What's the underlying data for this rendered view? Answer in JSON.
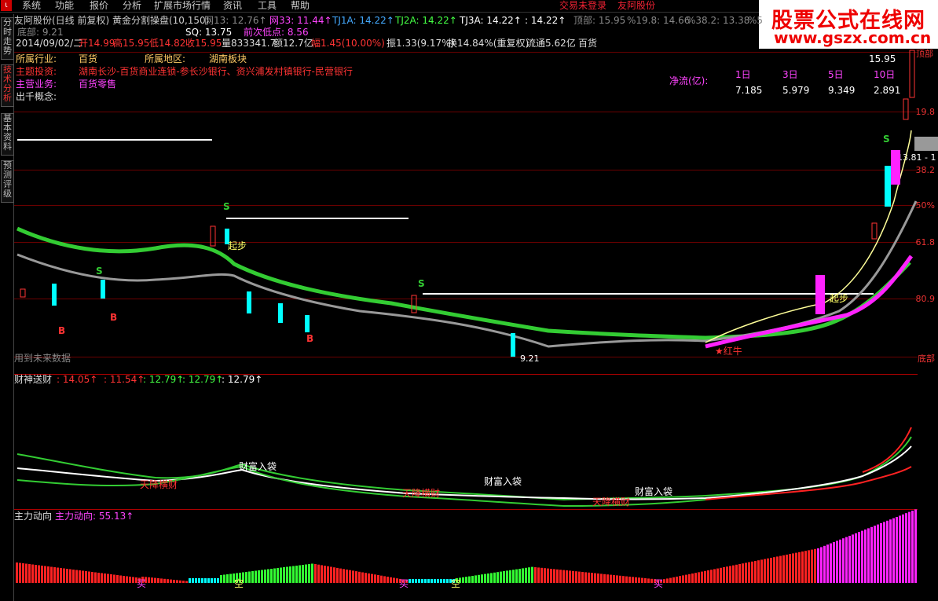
{
  "menu": {
    "items": [
      "系统",
      "功能",
      "报价",
      "分析",
      "扩展市场行情",
      "资讯",
      "工具",
      "帮助"
    ],
    "status": "交易未登录",
    "stock_name": "友阿股份"
  },
  "sidebar": {
    "tabs": [
      "分时走势",
      "技术分析",
      "基本资料",
      "预测评级"
    ]
  },
  "header": {
    "title": "友阿股份(日线 前复权) 黄金分割操盘(10,150)",
    "indicators": [
      {
        "label": "网13: 12.76↑",
        "color": "#888888"
      },
      {
        "label": "网33: 11.44↑",
        "color": "#ff44ff"
      },
      {
        "label": "TJ1A: 14.22↑",
        "color": "#44aaff"
      },
      {
        "label": "TJ2A: 14.22↑",
        "color": "#44ff44"
      },
      {
        "label": "TJ3A: 14.22↑",
        "color": "#ffffff"
      },
      {
        "label": ": 14.22↑",
        "color": "#ffffff"
      },
      {
        "label": "顶部: 15.95",
        "color": "#888888"
      },
      {
        "label": "%19.8: 14.66",
        "color": "#888888"
      },
      {
        "label": "%38.2: 13.38",
        "color": "#888888"
      },
      {
        "label": "%5",
        "color": "#888888"
      }
    ],
    "bottom_label": "底部: 9.21",
    "sq": "SQ: 13.75",
    "prev_low": "前次低点: 8.56"
  },
  "quote_line": {
    "date": "2014/09/02/二",
    "open": "开14.99",
    "high": "高15.95",
    "low": "低14.82",
    "close": "收15.95",
    "volume": "量833341.7",
    "amount": "额12.7亿",
    "change": "幅1.45(10.00%)",
    "amplitude": "振1.33(9.17%)",
    "turnover": "换14.84%(重复权)",
    "float": "流通5.62亿",
    "industry_tag": "百货"
  },
  "info": {
    "industry_label": "所属行业:",
    "industry_value": "百货",
    "region_label": "所属地区:",
    "region_value": "湖南板块",
    "invest_label": "主题投资:",
    "invest_value": "湖南长沙-百货商业连锁-参长沙银行、资兴浦发村镇银行-民营银行",
    "business_label": "主营业务:",
    "business_value": "百货零售",
    "concept_label": "出千概念:"
  },
  "net_flow": {
    "label": "净流(亿):",
    "periods": [
      "1日",
      "3日",
      "5日",
      "10日"
    ],
    "values": [
      "7.185",
      "5.979",
      "9.349",
      "2.891"
    ]
  },
  "right_axis": {
    "top_value": "15.95",
    "labels": [
      "19.8",
      "38.2",
      "50%",
      "61.8",
      "80.9",
      "底部"
    ],
    "partial": "13.81 - 1",
    "top_tag": "顶部"
  },
  "main_annotations": {
    "start_step": "起步",
    "start_step2": "起步",
    "future_data": "用到未来数据",
    "low_mark": "9.21",
    "red_bull": "★红牛",
    "buy": "B",
    "sell": "S"
  },
  "panel2": {
    "title": "财神送财",
    "values": [
      {
        "label": ": 14.05↑",
        "color": "#ff3333"
      },
      {
        "label": ": 11.54↑",
        "color": "#ff3333"
      },
      {
        "label": ": 12.79↑",
        "color": "#44ff44"
      },
      {
        "label": ": 12.79↑",
        "color": "#44ff44"
      },
      {
        "label": ": 12.79↑",
        "color": "#ffffff"
      }
    ],
    "wealth_in": "财富入袋",
    "sky_fall": "天降横财"
  },
  "panel3": {
    "title": "主力动向",
    "value_label": "主力动向: 55.13↑",
    "buy": "买",
    "empty": "空"
  },
  "watermark": {
    "line1": "股票公式在线网",
    "line2": "www.gszx.com.cn"
  },
  "colors": {
    "up": "#ff3333",
    "down": "#00ffff",
    "grid": "#6a0000",
    "green_ma": "#33cc33",
    "magenta_ma": "#ff22ff",
    "gray_ma": "#888888"
  }
}
